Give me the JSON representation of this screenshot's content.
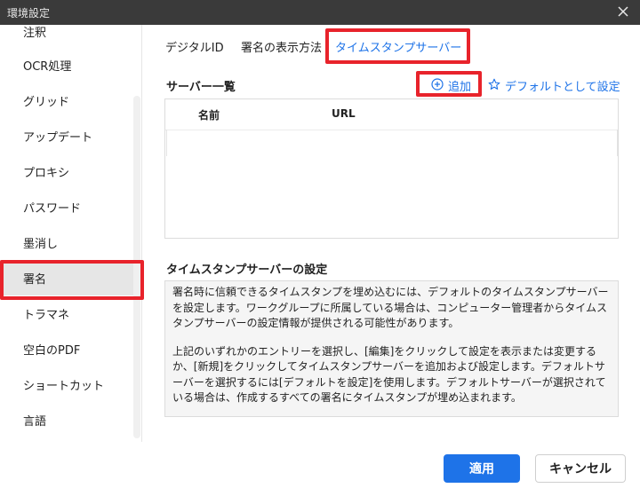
{
  "window": {
    "title": "環境設定",
    "close_icon": "close-icon"
  },
  "sidebar": {
    "items": [
      {
        "label": "注釈",
        "active": false
      },
      {
        "label": "OCR処理",
        "active": false
      },
      {
        "label": "グリッド",
        "active": false
      },
      {
        "label": "アップデート",
        "active": false
      },
      {
        "label": "プロキシ",
        "active": false
      },
      {
        "label": "パスワード",
        "active": false
      },
      {
        "label": "墨消し",
        "active": false
      },
      {
        "label": "署名",
        "active": true
      },
      {
        "label": "トラマネ",
        "active": false
      },
      {
        "label": "空白のPDF",
        "active": false
      },
      {
        "label": "ショートカット",
        "active": false
      },
      {
        "label": "言語",
        "active": false
      }
    ]
  },
  "tabs": [
    {
      "label": "デジタルID",
      "active": false
    },
    {
      "label": "署名の表示方法",
      "active": false
    },
    {
      "label": "タイムスタンプサーバー",
      "active": true
    }
  ],
  "server_list": {
    "title": "サーバー一覧",
    "add_label": "追加",
    "add_icon": "plus-circle-icon",
    "default_label": "デフォルトとして設定",
    "default_icon": "star-outline-icon",
    "columns": [
      "名前",
      "URL"
    ]
  },
  "settings": {
    "title": "タイムスタンプサーバーの設定",
    "paragraphs": [
      "署名時に信頼できるタイムスタンプを埋め込むには、デフォルトのタイムスタンプサーバーを設定します。ワークグループに所属している場合は、コンピューター管理者からタイムスタンプサーバーの設定情報が提供される可能性があります。",
      "上記のいずれかのエントリーを選択し、[編集]をクリックして設定を表示または変更するか、[新規]をクリックしてタイムスタンプサーバーを追加および設定します。デフォルトサーバーを選択するには[デフォルトを設定]を使用します。デフォルトサーバーが選択されている場合は、作成するすべての署名にタイムスタンプが埋め込まれます。"
    ]
  },
  "footer": {
    "apply_label": "適用",
    "cancel_label": "キャンセル"
  },
  "colors": {
    "accent": "#1e73e8",
    "highlight": "#e8232b",
    "titlebar": "#3a3a3a"
  }
}
